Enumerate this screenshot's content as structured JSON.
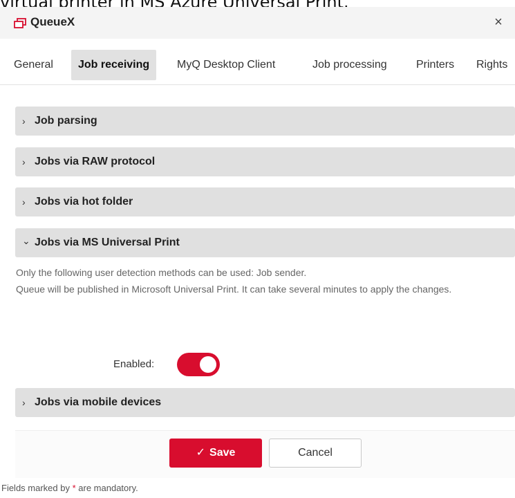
{
  "caption": "virtual printer in MS Azure Universal Print.",
  "dialog": {
    "title": "QueueX",
    "close_symbol": "×"
  },
  "tabs": [
    {
      "label": "General",
      "active": false
    },
    {
      "label": "Job receiving",
      "active": true
    },
    {
      "label": "MyQ Desktop Client",
      "active": false
    },
    {
      "label": "Job processing",
      "active": false
    },
    {
      "label": "Printers",
      "active": false
    },
    {
      "label": "Rights",
      "active": false
    }
  ],
  "sections": [
    {
      "label": "Job parsing",
      "expanded": false,
      "chevron": "›"
    },
    {
      "label": "Jobs via RAW protocol",
      "expanded": false,
      "chevron": "›"
    },
    {
      "label": "Jobs via hot folder",
      "expanded": false,
      "chevron": "›"
    },
    {
      "label": "Jobs via MS Universal Print",
      "expanded": true,
      "chevron": "⌄"
    },
    {
      "label": "Jobs via mobile devices",
      "expanded": false,
      "chevron": "›"
    }
  ],
  "universal_print": {
    "info_line1": "Only the following user detection methods can be used: Job sender.",
    "info_line2": "Queue will be published in Microsoft Universal Print. It can take several minutes to apply the changes.",
    "enabled_label": "Enabled:",
    "enabled": true
  },
  "footer": {
    "save_label": "Save",
    "save_icon": "✓",
    "cancel_label": "Cancel"
  },
  "mandatory_note": {
    "before": "Fields marked by ",
    "star": "*",
    "after": " are mandatory."
  },
  "colors": {
    "accent": "#d80d2e",
    "section_bg": "#e0e0e0",
    "active_tab_bg": "#e1e1e1"
  }
}
